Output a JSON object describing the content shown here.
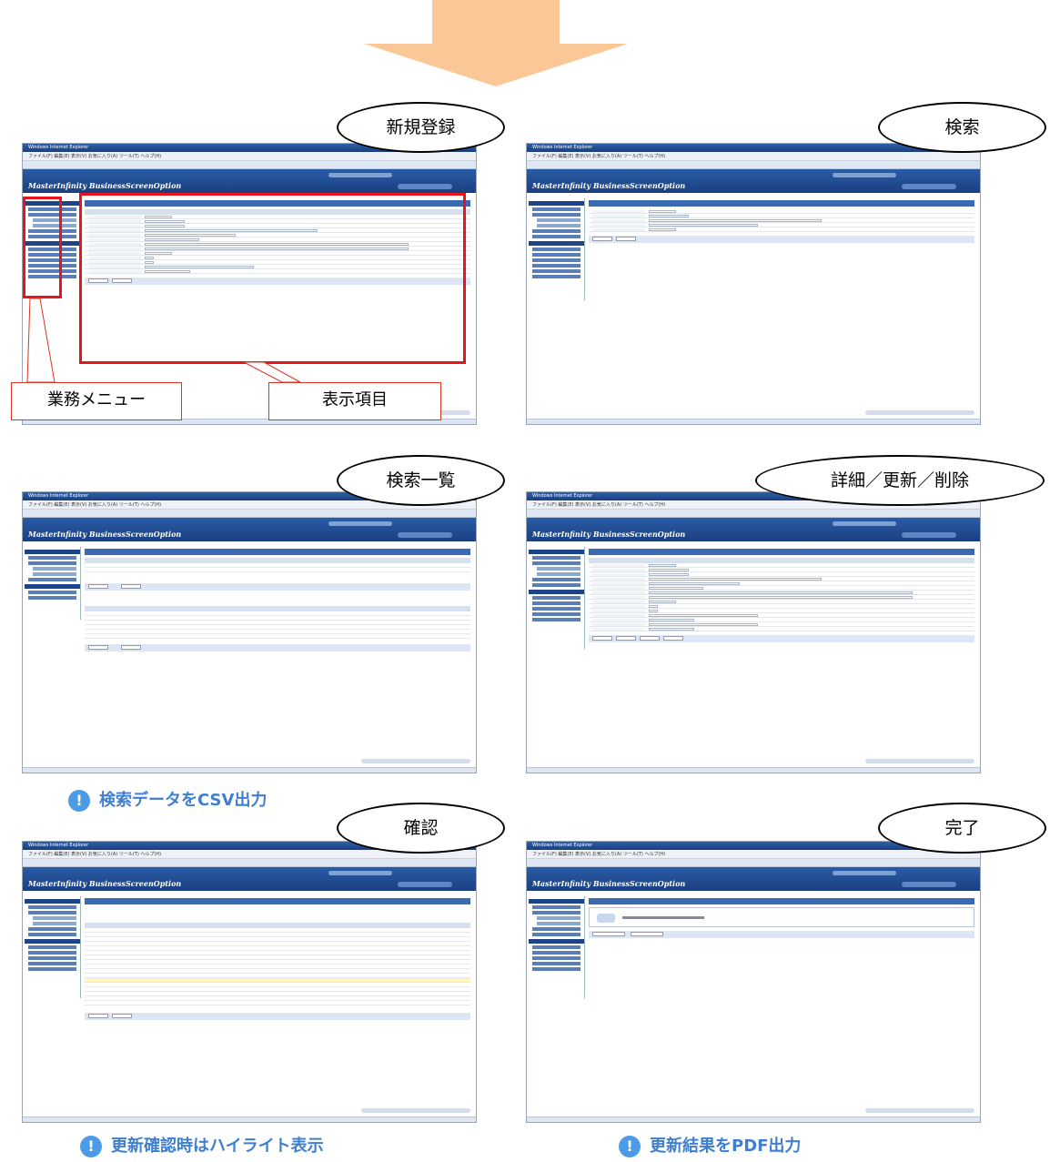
{
  "app_logo": "MasterInfinity BusinessScreenOption",
  "browser_title": "Windows Internet Explorer",
  "browser_menu": "ファイル(F)  編集(E)  表示(V)  お気に入り(A)  ツール(T)  ヘルプ(H)",
  "panels": {
    "new": {
      "bubble": "新規登録"
    },
    "search": {
      "bubble": "検索"
    },
    "list": {
      "bubble": "検索一覧"
    },
    "detail": {
      "bubble": "詳細／更新／削除"
    },
    "confirm": {
      "bubble": "確認"
    },
    "complete": {
      "bubble": "完了"
    }
  },
  "callouts": {
    "menu": "業務メニュー",
    "items": "表示項目"
  },
  "notes": {
    "csv": "検索データをCSV出力",
    "highlight": "更新確認時はハイライト表示",
    "pdf": "更新結果をPDF出力"
  },
  "icons": {
    "note_icon": "exclamation-circle-icon",
    "flow_arrow": "down-arrow-icon"
  },
  "colors": {
    "arrow": "#f9c896",
    "highlight_box": "#e8141b",
    "note": "#3f7fd2"
  }
}
